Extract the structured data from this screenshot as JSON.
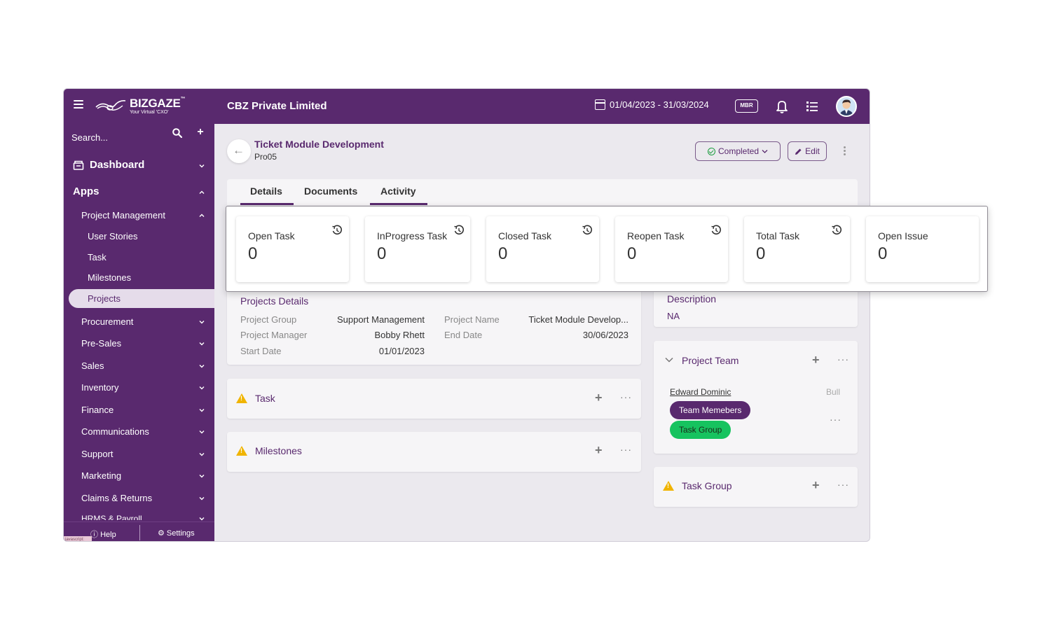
{
  "app": {
    "logo_text": "BIZGAZE",
    "logo_tm": "™",
    "logo_sub": "Your Virtual 'CXO'",
    "company": "CBZ Private Limited",
    "date_range": "01/04/2023 - 31/03/2024",
    "mbr_label": "MBR"
  },
  "sidebar": {
    "search_placeholder": "Search...",
    "add_label": "+",
    "dashboard": "Dashboard",
    "apps": "Apps",
    "project_management": "Project Management",
    "pm_items": [
      "User Stories",
      "Task",
      "Milestones",
      "Projects"
    ],
    "modules": [
      "Procurement",
      "Pre-Sales",
      "Sales",
      "Inventory",
      "Finance",
      "Communications",
      "Support",
      "Marketing",
      "Claims & Returns",
      "HRMS & Payroll"
    ],
    "help": "Help",
    "settings": "Settings",
    "js_tag": "javascript:"
  },
  "header": {
    "title": "Ticket Module Development",
    "code": "Pro05",
    "status": "Completed",
    "edit": "Edit"
  },
  "tabs": [
    "Details",
    "Documents",
    "Activity"
  ],
  "stats": [
    {
      "label": "Open Task",
      "value": "0"
    },
    {
      "label": "InProgress Task",
      "value": "0"
    },
    {
      "label": "Closed Task",
      "value": "0"
    },
    {
      "label": "Reopen Task",
      "value": "0"
    },
    {
      "label": "Total Task",
      "value": "0"
    },
    {
      "label": "Open Issue",
      "value": "0"
    }
  ],
  "details": {
    "title": "Projects Details",
    "project_group_label": "Project Group",
    "project_group": "Support Management",
    "project_name_label": "Project Name",
    "project_name": "Ticket Module Develop...",
    "project_manager_label": "Project Manager",
    "project_manager": "Bobby Rhett",
    "end_date_label": "End Date",
    "end_date": "30/06/2023",
    "start_date_label": "Start Date",
    "start_date": "01/01/2023"
  },
  "description": {
    "title": "Description",
    "value": "NA"
  },
  "sections": {
    "task": "Task",
    "milestones": "Milestones",
    "task_group": "Task Group"
  },
  "team": {
    "title": "Project Team",
    "member": "Edward Dominic",
    "role": "Bull",
    "chip_members": "Team Memebers",
    "chip_group": "Task Group"
  },
  "colors": {
    "brand": "#59296e",
    "success": "#1a9c3e",
    "chip_group": "#16c35f",
    "warning": "#f0b400"
  }
}
